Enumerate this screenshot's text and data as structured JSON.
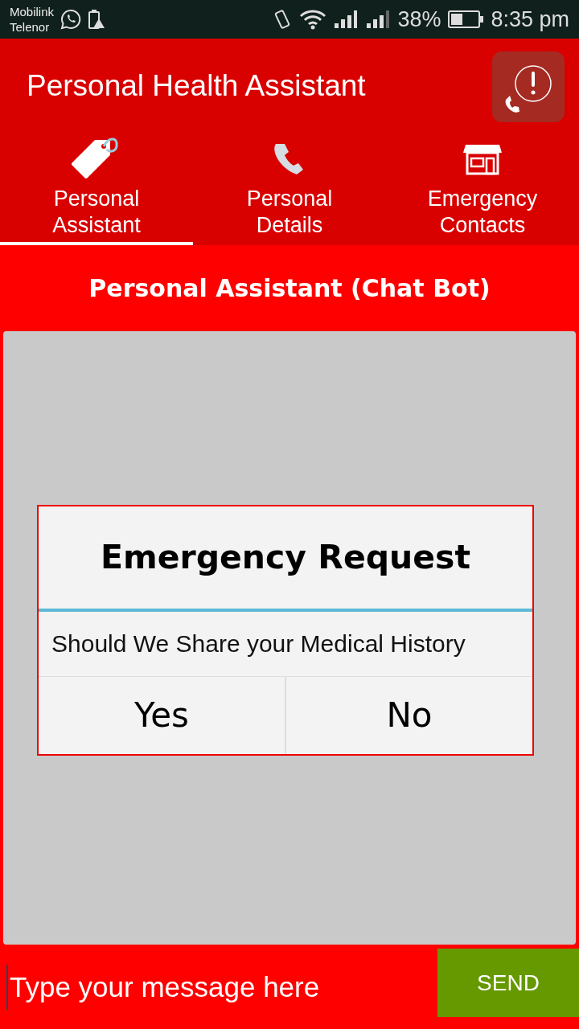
{
  "status_bar": {
    "carriers": [
      "Mobilink",
      "Telenor"
    ],
    "battery": "38%",
    "time": "8:35 pm"
  },
  "app_bar": {
    "title": "Personal Health Assistant"
  },
  "tabs": [
    {
      "label": "Personal Assistant",
      "kind": "tag",
      "selected": true
    },
    {
      "label": "Personal Details",
      "kind": "phone",
      "selected": false
    },
    {
      "label": "Emergency Contacts",
      "kind": "store",
      "selected": false
    }
  ],
  "chat": {
    "title": "Personal Assistant (Chat Bot)"
  },
  "dialog": {
    "title": "Emergency Request",
    "message": "Should We Share your Medical History",
    "buttons": [
      "Yes",
      "No"
    ]
  },
  "composer": {
    "placeholder": "Type your message here",
    "send": "SEND"
  }
}
